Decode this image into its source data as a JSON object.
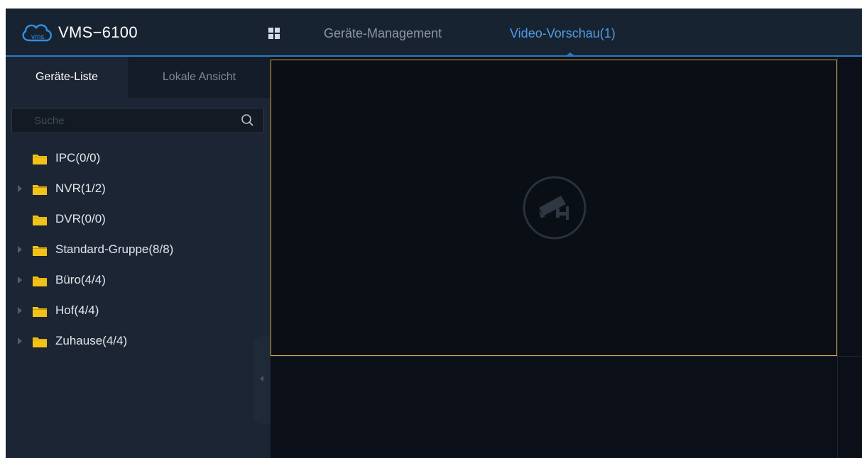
{
  "app": {
    "title": "VMS−6100",
    "logo_text": "vms"
  },
  "nav": {
    "grid_icon": "grid-menu-icon",
    "tabs": [
      {
        "label": "Geräte-Management",
        "active": false
      },
      {
        "label": "Video-Vorschau(1)",
        "active": true
      }
    ]
  },
  "sidebar": {
    "tabs": [
      {
        "label": "Geräte-Liste",
        "active": true
      },
      {
        "label": "Lokale Ansicht",
        "active": false
      }
    ],
    "search": {
      "placeholder": "Suche",
      "value": ""
    },
    "tree": [
      {
        "label": "IPC(0/0)",
        "expandable": false
      },
      {
        "label": "NVR(1/2)",
        "expandable": true
      },
      {
        "label": "DVR(0/0)",
        "expandable": false
      },
      {
        "label": "Standard-Gruppe(8/8)",
        "expandable": true
      },
      {
        "label": "Büro(4/4)",
        "expandable": true
      },
      {
        "label": "Hof(4/4)",
        "expandable": true
      },
      {
        "label": "Zuhause(4/4)",
        "expandable": true
      }
    ]
  },
  "colors": {
    "accent": "#4f9be6",
    "selected_pane_border": "#d4ab42",
    "folder": "#f2c316",
    "topbar": "#182331",
    "sidebar": "#1b2533",
    "video_bg": "#0b0f17"
  }
}
